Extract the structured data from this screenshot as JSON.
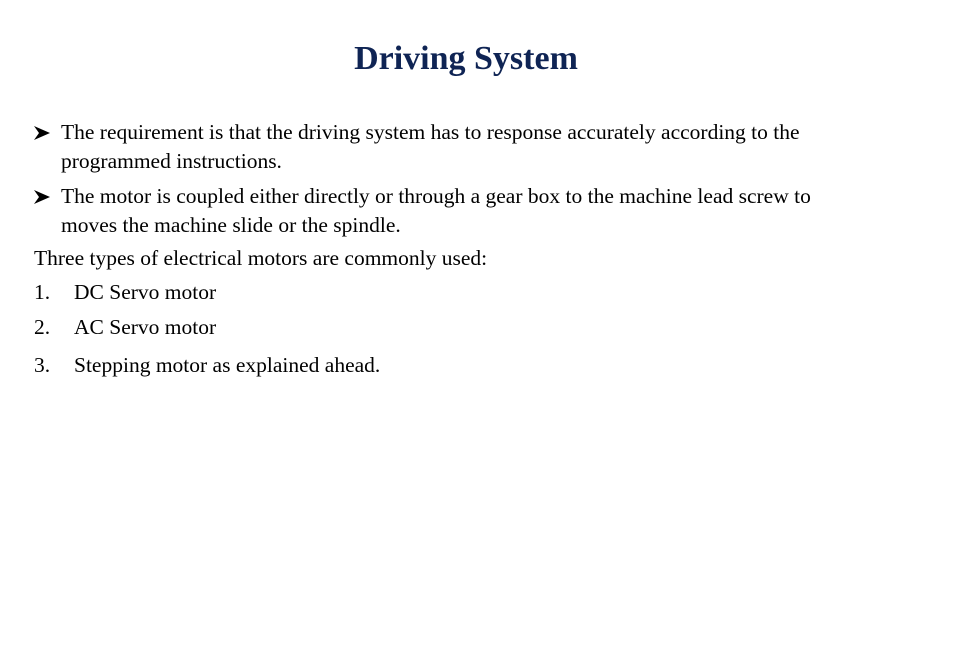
{
  "slide": {
    "title": "Driving System",
    "bullets": [
      {
        "icon": "arrow-bullet-icon",
        "lines": [
          "The requirement is that the driving system has to response accurately according to the",
          "programmed instructions."
        ]
      },
      {
        "icon": "arrow-bullet-icon",
        "lines": [
          "The motor is coupled either directly or through a gear box to the machine lead screw to",
          "moves the machine slide or the spindle."
        ]
      }
    ],
    "intro": "Three types of electrical motors are commonly used:",
    "motor_types": [
      {
        "number": "1.",
        "label": "DC Servo motor"
      },
      {
        "number": "2.",
        "label": "AC Servo motor"
      },
      {
        "number": "3.",
        "label": "Stepping motor as explained ahead."
      }
    ],
    "colors": {
      "title": "#0f2454",
      "body": "#000000",
      "background": "#ffffff"
    }
  }
}
